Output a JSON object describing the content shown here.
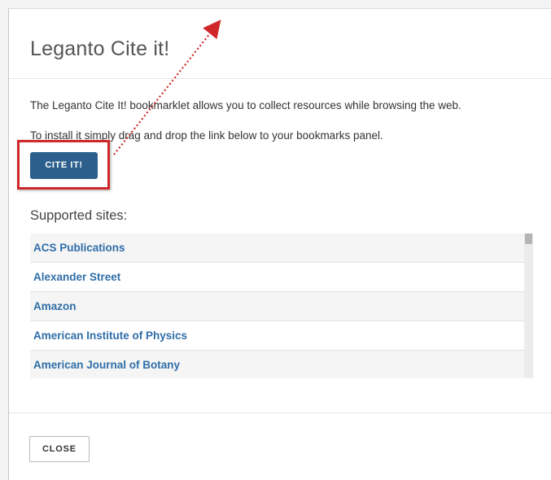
{
  "modal": {
    "title": "Leganto Cite it!",
    "intro": "The Leganto Cite It! bookmarklet allows you to collect resources while browsing the web.",
    "install": "To install it simply drag and drop the link below to your bookmarks panel.",
    "cite_button_label": "CITE IT!",
    "supported_label": "Supported sites:",
    "close_button_label": "CLOSE"
  },
  "sites": [
    "ACS Publications",
    "Alexander Street",
    "Amazon",
    "American Institute of Physics",
    "American Journal of Botany"
  ],
  "colors": {
    "button_primary": "#2c5f8c",
    "link": "#2f6ea8",
    "annotation": "#d0282a"
  }
}
